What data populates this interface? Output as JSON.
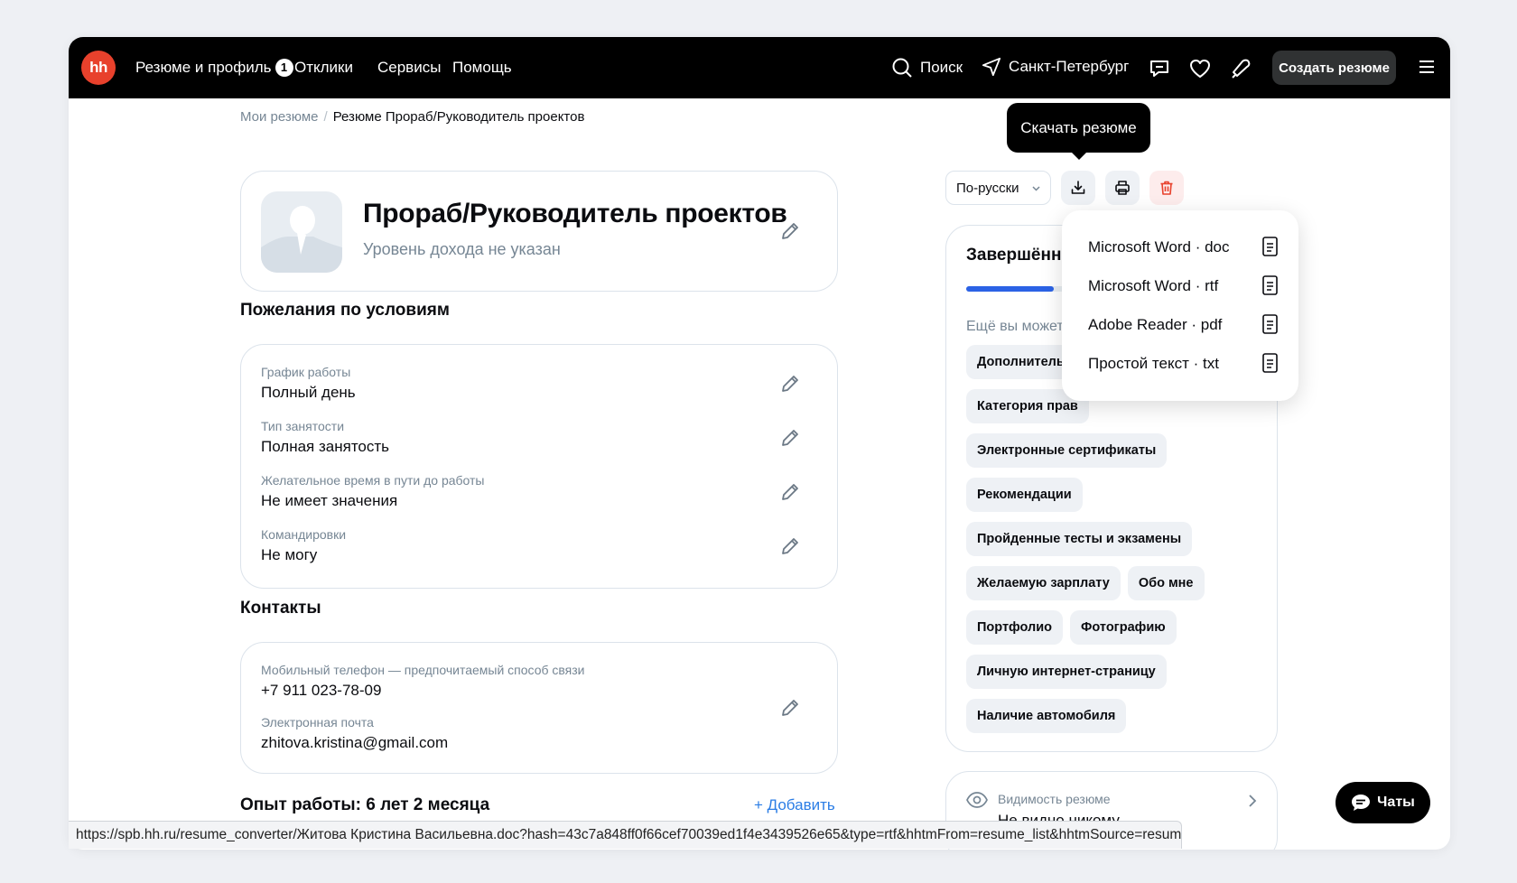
{
  "nav": {
    "logo": "hh",
    "items": [
      {
        "label": "Резюме и профиль",
        "badge": "1"
      },
      {
        "label": "Отклики"
      },
      {
        "label": "Сервисы"
      },
      {
        "label": "Помощь"
      }
    ],
    "search_label": "Поиск",
    "city": "Санкт-Петербург",
    "create_resume": "Создать резюме"
  },
  "breadcrumb": {
    "parent": "Мои резюме",
    "separator": "/",
    "current": "Резюме Прораб/Руководитель проектов"
  },
  "resume": {
    "title": "Прораб/Руководитель проектов",
    "salary": "Уровень дохода не указан"
  },
  "conditions": {
    "heading": "Пожелания по условиям",
    "fields": [
      {
        "label": "График работы",
        "value": "Полный день"
      },
      {
        "label": "Тип занятости",
        "value": "Полная занятость"
      },
      {
        "label": "Желательное время в пути до работы",
        "value": "Не имеет значения"
      },
      {
        "label": "Командировки",
        "value": "Не могу"
      }
    ]
  },
  "contacts": {
    "heading": "Контакты",
    "phone_label": "Мобильный телефон — предпочитаемый способ связи",
    "phone": "+7 911 023-78-09",
    "email_label": "Электронная почта",
    "email": "zhitova.kristina@gmail.com"
  },
  "experience": {
    "heading": "Опыт работы: 6 лет 2 месяца",
    "add_label": "+ Добавить"
  },
  "toolbar": {
    "language": "По-русски",
    "tooltip": "Скачать резюме"
  },
  "download_menu": [
    {
      "label": "Microsoft Word · doc"
    },
    {
      "label": "Microsoft Word · rtf"
    },
    {
      "label": "Adobe Reader · pdf"
    },
    {
      "label": "Простой текст · txt"
    }
  ],
  "completeness": {
    "title": "Завершённость",
    "progress": 0.3,
    "more_text": "Ещё вы можете",
    "chips": [
      "Дополнительн",
      "Категория прав",
      "Электронные сертификаты",
      "Рекомендации",
      "Пройденные тесты и экзамены",
      "Желаемую зарплату",
      "Обо мне",
      "Портфолио",
      "Фотографию",
      "Личную интернет-страницу",
      "Наличие автомобиля"
    ]
  },
  "visibility": {
    "label": "Видимость резюме",
    "value": "Не видно никому"
  },
  "chats": {
    "label": "Чаты"
  },
  "status_url": "https://spb.hh.ru/resume_converter/Житова Кристина Васильевна.doc?hash=43c7a848ff0f66cef70039ed1f4e3439526e65&type=rtf&hhtmFrom=resume_list&hhtmSource=resume",
  "colors": {
    "brand": "#e8412c",
    "link": "#2b7de5",
    "progress": "#2b62e5",
    "danger": "#e8412c"
  }
}
